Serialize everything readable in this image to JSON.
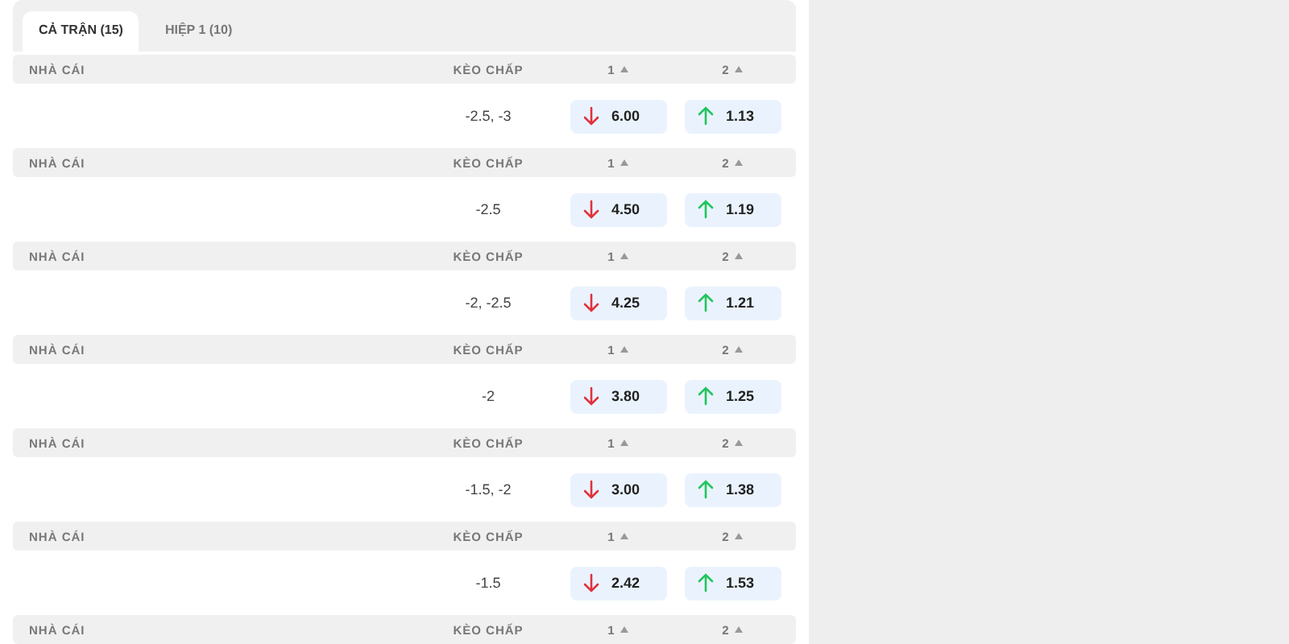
{
  "tabs": [
    {
      "label": "CẢ TRẬN (15)",
      "selected": true
    },
    {
      "label": "HIỆP 1 (10)",
      "selected": false
    }
  ],
  "sections": [
    {
      "header": {
        "bookmaker": "NHÀ CÁI",
        "handicap": "KÈO CHẤP",
        "col1": "1",
        "col2": "2"
      },
      "handicap": "-2.5, -3",
      "odds": [
        {
          "value": "6.00",
          "kind": "down"
        },
        {
          "value": "1.13",
          "kind": "up"
        }
      ]
    },
    {
      "header": {
        "bookmaker": "NHÀ CÁI",
        "handicap": "KÈO CHẤP",
        "col1": "1",
        "col2": "2"
      },
      "handicap": "-2.5",
      "odds": [
        {
          "value": "4.50",
          "kind": "down"
        },
        {
          "value": "1.19",
          "kind": "up"
        }
      ]
    },
    {
      "header": {
        "bookmaker": "NHÀ CÁI",
        "handicap": "KÈO CHẤP",
        "col1": "1",
        "col2": "2"
      },
      "handicap": "-2, -2.5",
      "odds": [
        {
          "value": "4.25",
          "kind": "down"
        },
        {
          "value": "1.21",
          "kind": "up"
        }
      ]
    },
    {
      "header": {
        "bookmaker": "NHÀ CÁI",
        "handicap": "KÈO CHẤP",
        "col1": "1",
        "col2": "2"
      },
      "handicap": "-2",
      "odds": [
        {
          "value": "3.80",
          "kind": "down"
        },
        {
          "value": "1.25",
          "kind": "up"
        }
      ]
    },
    {
      "header": {
        "bookmaker": "NHÀ CÁI",
        "handicap": "KÈO CHẤP",
        "col1": "1",
        "col2": "2"
      },
      "handicap": "-1.5, -2",
      "odds": [
        {
          "value": "3.00",
          "kind": "down"
        },
        {
          "value": "1.38",
          "kind": "up"
        }
      ]
    },
    {
      "header": {
        "bookmaker": "NHÀ CÁI",
        "handicap": "KÈO CHẤP",
        "col1": "1",
        "col2": "2"
      },
      "handicap": "-1.5",
      "odds": [
        {
          "value": "2.42",
          "kind": "down"
        },
        {
          "value": "1.53",
          "kind": "up"
        }
      ]
    },
    {
      "header": {
        "bookmaker": "NHÀ CÁI",
        "handicap": "KÈO CHẤP",
        "col1": "1",
        "col2": "2"
      }
    }
  ]
}
